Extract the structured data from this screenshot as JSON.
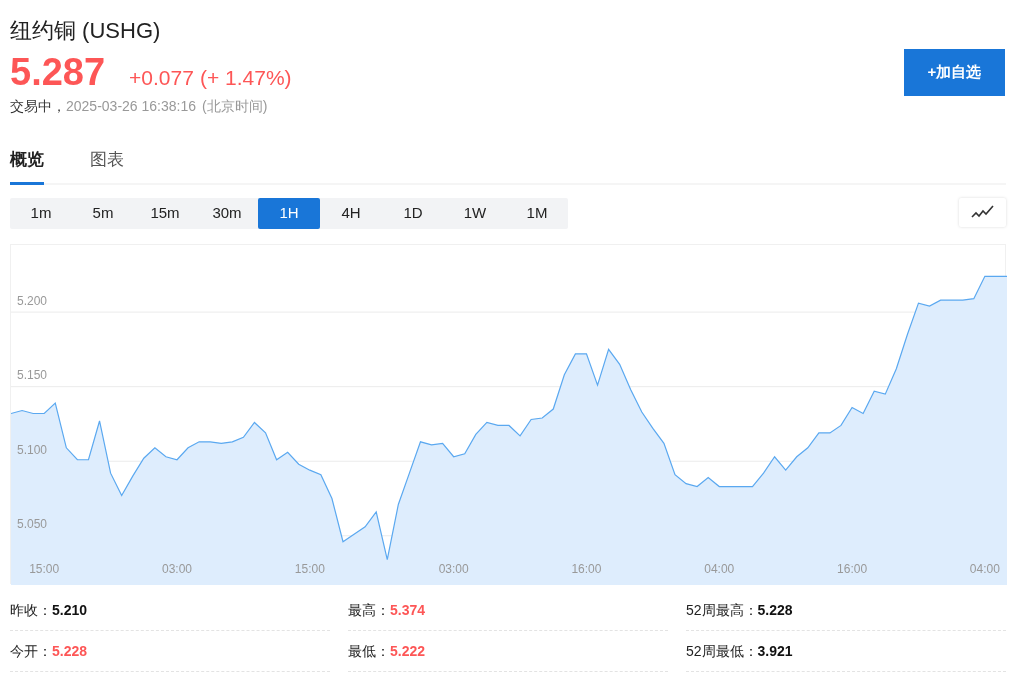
{
  "title": "纽约铜 (USHG)",
  "price": "5.287",
  "change": "+0.077",
  "change_pct": "(+ 1.47%)",
  "status": "交易中，",
  "timestamp": "2025-03-26 16:38:16",
  "timezone": "(北京时间)",
  "watch_button": "+加自选",
  "tabs": [
    {
      "label": "概览",
      "selected": true
    },
    {
      "label": "图表",
      "selected": false
    }
  ],
  "periods": [
    {
      "label": "1m",
      "selected": false
    },
    {
      "label": "5m",
      "selected": false
    },
    {
      "label": "15m",
      "selected": false
    },
    {
      "label": "30m",
      "selected": false
    },
    {
      "label": "1H",
      "selected": true
    },
    {
      "label": "4H",
      "selected": false
    },
    {
      "label": "1D",
      "selected": false
    },
    {
      "label": "1W",
      "selected": false
    },
    {
      "label": "1M",
      "selected": false
    }
  ],
  "chart": {
    "chart_data": {
      "type": "area",
      "categories": [
        null,
        null,
        null,
        "15:00",
        null,
        null,
        null,
        null,
        null,
        null,
        null,
        null,
        null,
        null,
        null,
        "03:00",
        null,
        null,
        null,
        null,
        null,
        null,
        null,
        null,
        null,
        null,
        null,
        "15:00",
        null,
        null,
        null,
        null,
        null,
        null,
        null,
        null,
        null,
        null,
        null,
        null,
        "03:00",
        null,
        null,
        null,
        null,
        null,
        null,
        null,
        null,
        null,
        null,
        null,
        "16:00",
        null,
        null,
        null,
        null,
        null,
        null,
        null,
        null,
        null,
        null,
        null,
        "04:00",
        null,
        null,
        null,
        null,
        null,
        null,
        null,
        null,
        null,
        null,
        null,
        "16:00",
        null,
        null,
        null,
        null,
        null,
        null,
        null,
        null,
        null,
        null,
        null,
        "04:00",
        null,
        null
      ],
      "series": [
        {
          "color": "#5aa8f0",
          "values": [
            5.132,
            5.134,
            5.132,
            5.132,
            5.139,
            5.109,
            5.101,
            5.101,
            5.127,
            5.092,
            5.077,
            5.09,
            5.102,
            5.109,
            5.103,
            5.101,
            5.109,
            5.113,
            5.113,
            5.112,
            5.113,
            5.116,
            5.126,
            5.119,
            5.101,
            5.106,
            5.098,
            5.094,
            5.091,
            5.075,
            5.046,
            5.051,
            5.056,
            5.066,
            5.034,
            5.071,
            5.092,
            5.113,
            5.111,
            5.112,
            5.103,
            5.105,
            5.118,
            5.126,
            5.124,
            5.124,
            5.117,
            5.128,
            5.129,
            5.135,
            5.158,
            5.172,
            5.172,
            5.151,
            5.175,
            5.165,
            5.148,
            5.133,
            5.122,
            5.112,
            5.091,
            5.085,
            5.083,
            5.089,
            5.083,
            5.083,
            5.083,
            5.083,
            5.092,
            5.103,
            5.094,
            5.103,
            5.109,
            5.119,
            5.119,
            5.124,
            5.136,
            5.132,
            5.147,
            5.145,
            5.162,
            5.185,
            5.206,
            5.204,
            5.208,
            5.208,
            5.208,
            5.209,
            5.224,
            5.224,
            5.224
          ]
        }
      ],
      "ylim": [
        5.017,
        5.245
      ],
      "grid": "y",
      "yticks": [
        {
          "value": 5.05,
          "label": "5.050"
        },
        {
          "value": 5.1,
          "label": "5.100"
        },
        {
          "value": 5.15,
          "label": "5.150"
        },
        {
          "value": 5.2,
          "label": "5.200"
        }
      ]
    }
  },
  "stats": [
    {
      "label": "昨收：",
      "value": "5.210",
      "kind": "plain"
    },
    {
      "label": "最高：",
      "value": "5.374",
      "kind": "up"
    },
    {
      "label": "52周最高：",
      "value": "5.228",
      "kind": "plain"
    },
    {
      "label": "今开：",
      "value": "5.228",
      "kind": "up"
    },
    {
      "label": "最低：",
      "value": "5.222",
      "kind": "up"
    },
    {
      "label": "52周最低：",
      "value": "3.921",
      "kind": "plain"
    }
  ]
}
